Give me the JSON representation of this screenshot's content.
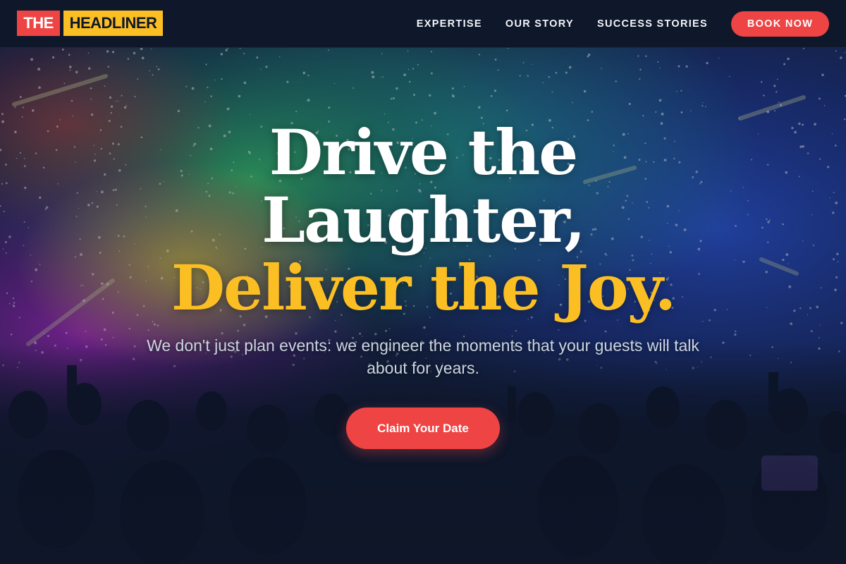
{
  "brand": {
    "part1": "THE",
    "part2": "HEADLINER"
  },
  "nav": {
    "links": [
      {
        "label": "EXPERTISE"
      },
      {
        "label": "OUR STORY"
      },
      {
        "label": "SUCCESS STORIES"
      }
    ],
    "cta_label": "BOOK NOW"
  },
  "hero": {
    "headline_line1": "Drive the",
    "headline_line2": "Laughter,",
    "headline_line3": "Deliver the Joy.",
    "subtitle": "We don't just plan events: we engineer the moments that your guests will talk about for years.",
    "cta_label": "Claim Your Date",
    "background": "concert crowd with colorful stage lights and confetti"
  },
  "colors": {
    "nav_bg": "#0f172a",
    "accent_red": "#ef4444",
    "accent_yellow": "#fbbf24",
    "text_light": "#f1f5f9",
    "text_muted": "#cbd5e1"
  }
}
